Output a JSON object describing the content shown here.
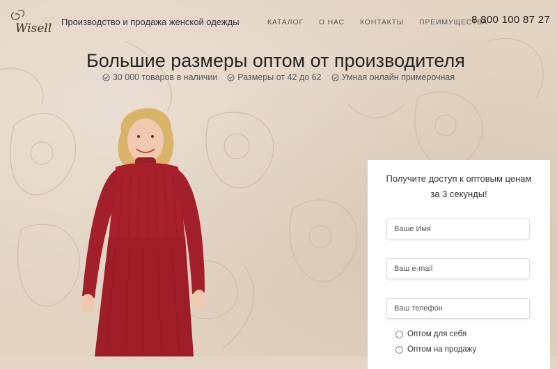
{
  "header": {
    "logo_text": "Wisell",
    "tagline": "Производство и продажа женской одежды",
    "nav": [
      "КАТАЛОГ",
      "О НАС",
      "КОНТАКТЫ",
      "ПРЕИМУЩЕСТВА"
    ],
    "phone": "8 800 100 87 27"
  },
  "hero": {
    "title": "Большие размеры оптом от производителя",
    "features": [
      "30 000 товаров в наличии",
      "Размеры от 42 до 62",
      "Умная онлайн примерочная"
    ]
  },
  "form": {
    "title_line1": "Получите доступ к оптовым ценам",
    "title_line2": "за 3 секунды!",
    "name_placeholder": "Ваше Имя",
    "email_placeholder": "Ваш e-mail",
    "phone_placeholder": "Ваш телефон",
    "options": [
      "Оптом для себя",
      "Оптом на продажу"
    ]
  },
  "colors": {
    "background": "#e2d3c3",
    "dress": "#a8202a",
    "text_dark": "#262626"
  }
}
